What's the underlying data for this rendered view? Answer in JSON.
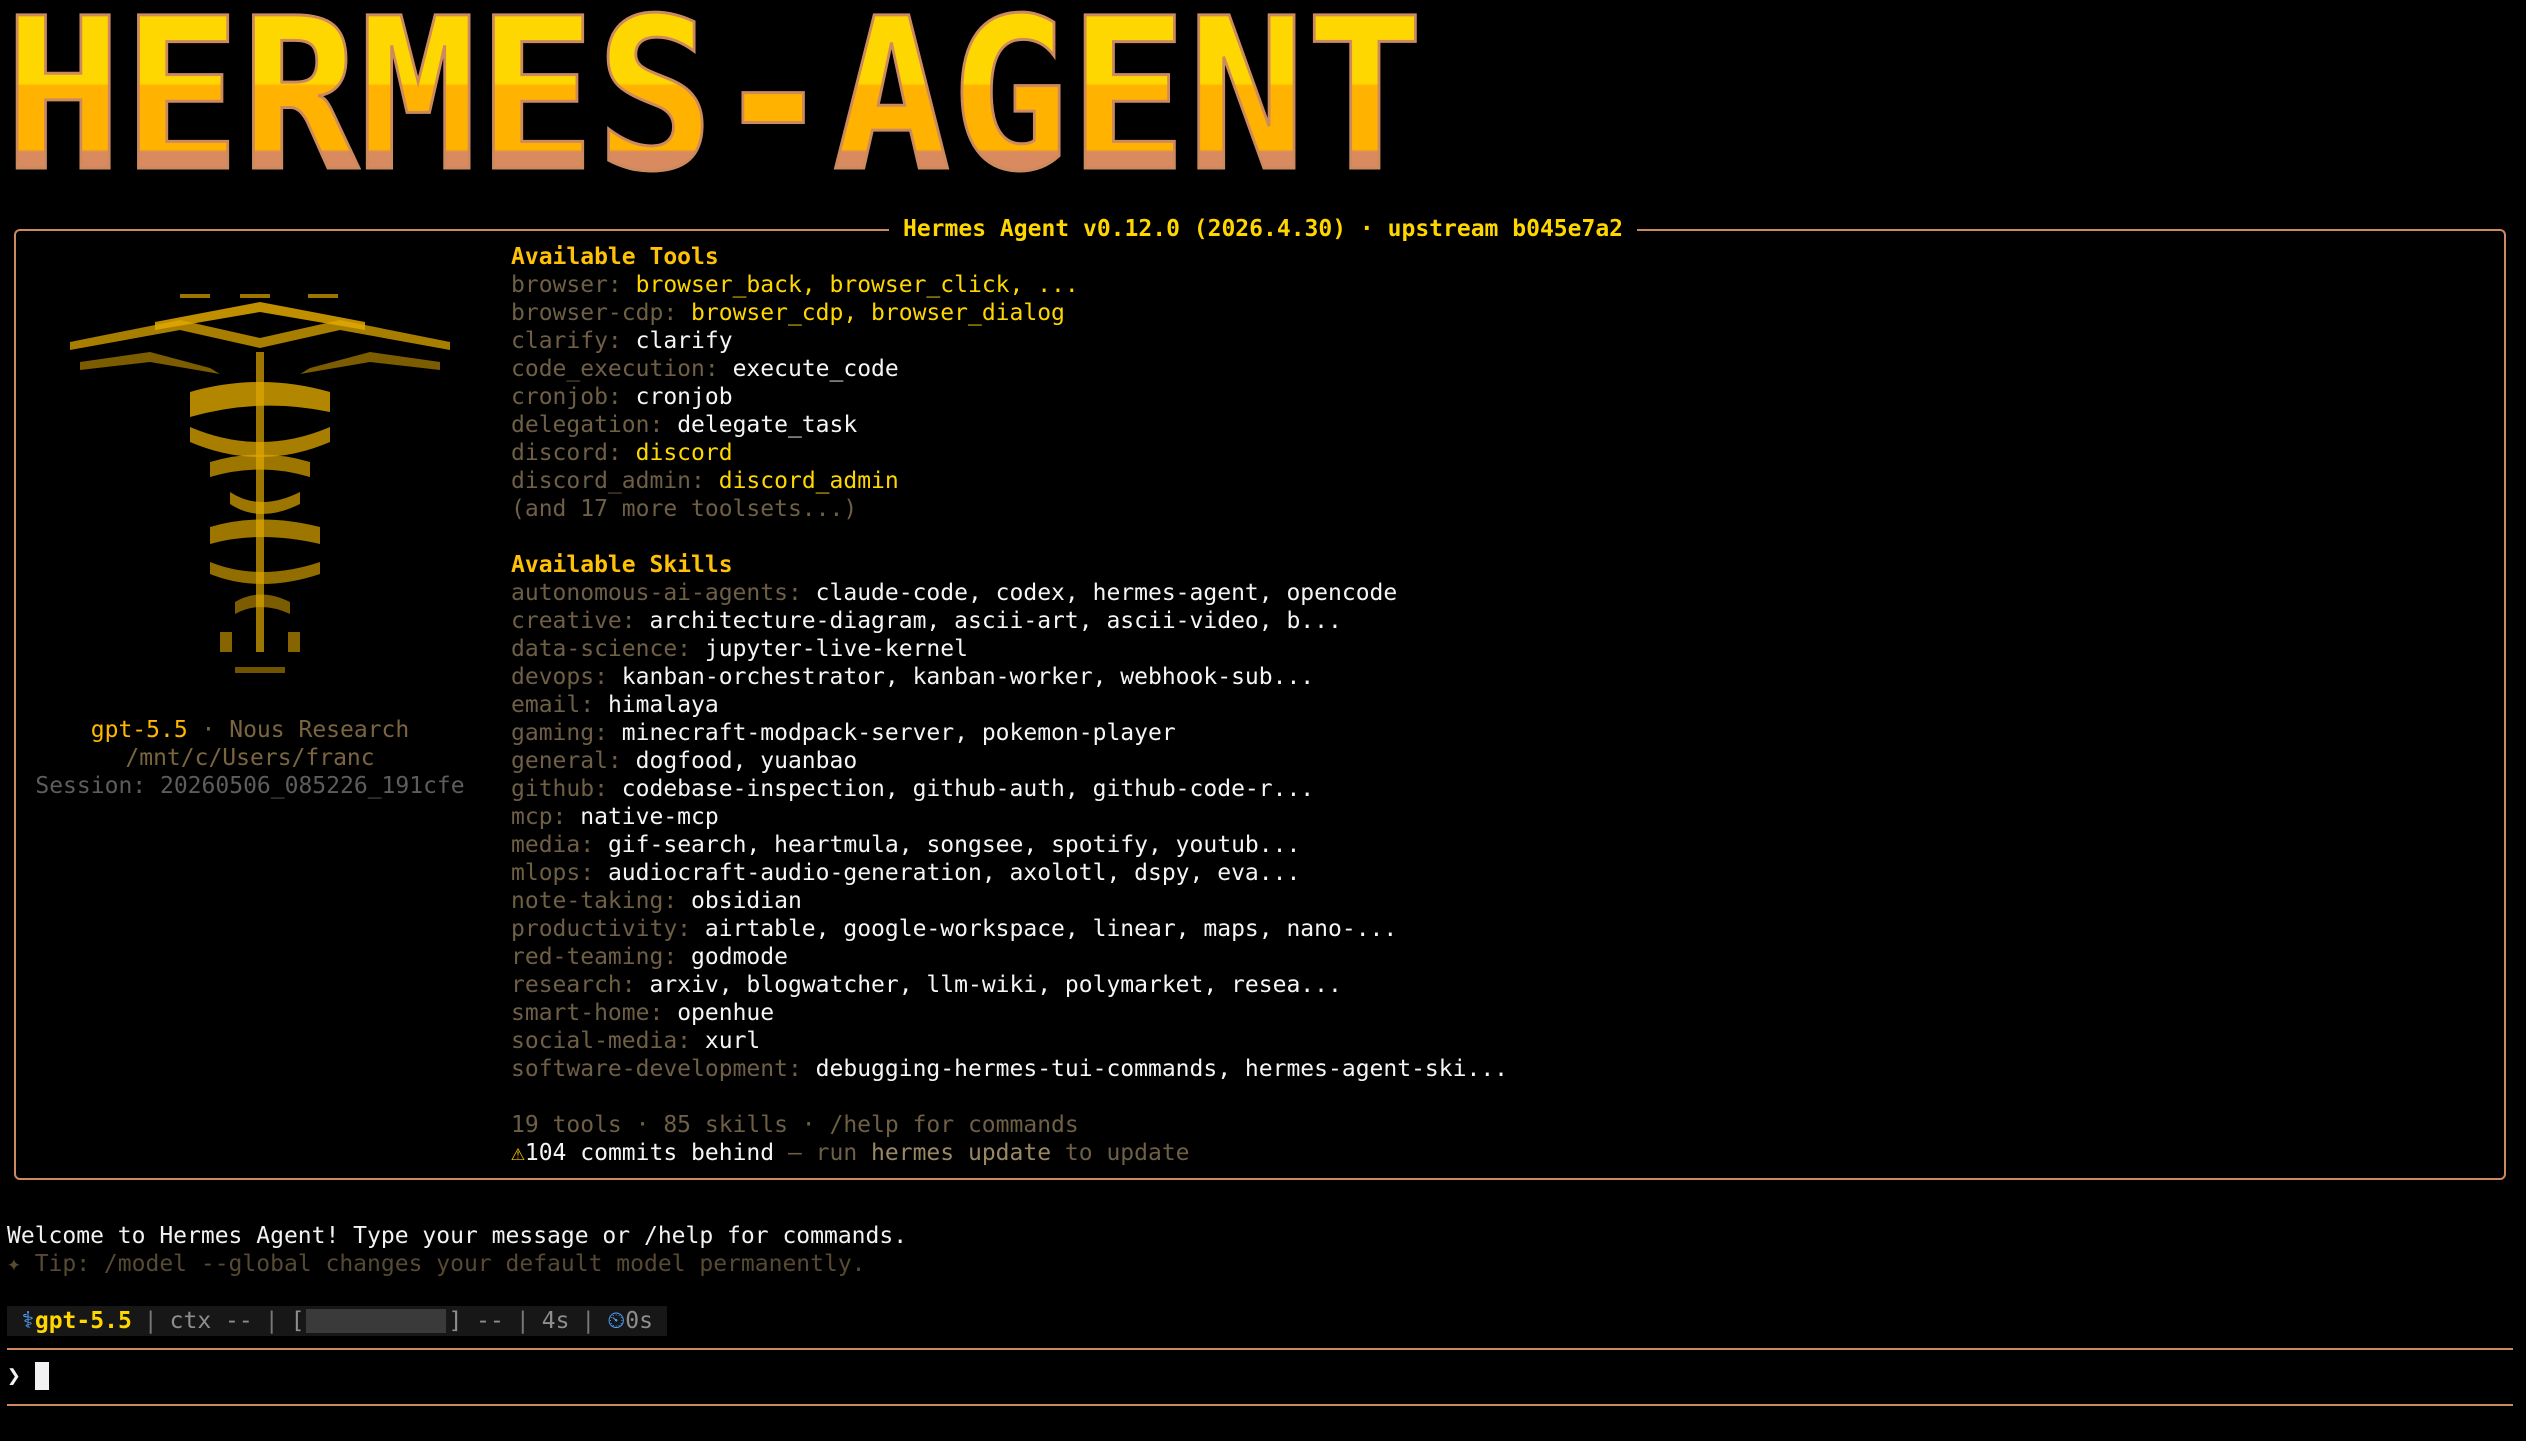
{
  "banner": {
    "text": "HERMES-AGENT"
  },
  "panel": {
    "title": "Hermes Agent v0.12.0 (2026.4.30) · upstream b045e7a2"
  },
  "sidebar": {
    "model": "gpt-5.5",
    "separator": " · ",
    "provider": "Nous Research",
    "cwd": "/mnt/c/Users/franc",
    "session": "Session: 20260506_085226_191cfe"
  },
  "tools": {
    "heading": "Available Tools",
    "items": [
      {
        "cat": "browser:",
        "val": "browser_back, browser_click, ...",
        "tone": "y"
      },
      {
        "cat": "browser-cdp:",
        "val": "browser_cdp, browser_dialog",
        "tone": "y"
      },
      {
        "cat": "clarify:",
        "val": "clarify",
        "tone": "w"
      },
      {
        "cat": "code_execution:",
        "val": "execute_code",
        "tone": "w"
      },
      {
        "cat": "cronjob:",
        "val": "cronjob",
        "tone": "w"
      },
      {
        "cat": "delegation:",
        "val": "delegate_task",
        "tone": "w"
      },
      {
        "cat": "discord:",
        "val": "discord",
        "tone": "y"
      },
      {
        "cat": "discord_admin:",
        "val": "discord_admin",
        "tone": "y"
      }
    ],
    "more": "(and 17 more toolsets...)"
  },
  "skills": {
    "heading": "Available Skills",
    "items": [
      {
        "cat": "autonomous-ai-agents:",
        "val": "claude-code, codex, hermes-agent, opencode"
      },
      {
        "cat": "creative:",
        "val": "architecture-diagram, ascii-art, ascii-video, b..."
      },
      {
        "cat": "data-science:",
        "val": "jupyter-live-kernel"
      },
      {
        "cat": "devops:",
        "val": "kanban-orchestrator, kanban-worker, webhook-sub..."
      },
      {
        "cat": "email:",
        "val": "himalaya"
      },
      {
        "cat": "gaming:",
        "val": "minecraft-modpack-server, pokemon-player"
      },
      {
        "cat": "general:",
        "val": "dogfood, yuanbao"
      },
      {
        "cat": "github:",
        "val": "codebase-inspection, github-auth, github-code-r..."
      },
      {
        "cat": "mcp:",
        "val": "native-mcp"
      },
      {
        "cat": "media:",
        "val": "gif-search, heartmula, songsee, spotify, youtub..."
      },
      {
        "cat": "mlops:",
        "val": "audiocraft-audio-generation, axolotl, dspy, eva..."
      },
      {
        "cat": "note-taking:",
        "val": "obsidian"
      },
      {
        "cat": "productivity:",
        "val": "airtable, google-workspace, linear, maps, nano-..."
      },
      {
        "cat": "red-teaming:",
        "val": "godmode"
      },
      {
        "cat": "research:",
        "val": "arxiv, blogwatcher, llm-wiki, polymarket, resea..."
      },
      {
        "cat": "smart-home:",
        "val": "openhue"
      },
      {
        "cat": "social-media:",
        "val": "xurl"
      },
      {
        "cat": "software-development:",
        "val": "debugging-hermes-tui-commands, hermes-agent-ski..."
      }
    ]
  },
  "summary": "19 tools · 85 skills · /help for commands",
  "update": {
    "warn_icon": "⚠",
    "count": "104 commits behind",
    "dash": " — run ",
    "cmd": "hermes update",
    "tail": " to update"
  },
  "welcome": "Welcome to Hermes Agent! Type your message or /help for commands.",
  "tip": "✦ Tip: /model --global changes your default model permanently.",
  "statusbar": {
    "model_icon": "⚕",
    "model": "gpt-5.5",
    "ctx": "ctx --",
    "bar_open": "[",
    "bar_close": "] --",
    "elapsed": "4s",
    "timer_icon": "⏲",
    "timer": "0s",
    "context_fill": 0
  },
  "prompt": {
    "symbol": "❯"
  },
  "colors": {
    "accent": "#ffd700",
    "border": "#cd8a5e",
    "banner_top": "#ffd700",
    "banner_mid": "#ffb300",
    "banner_bottom": "#d98a5e"
  }
}
